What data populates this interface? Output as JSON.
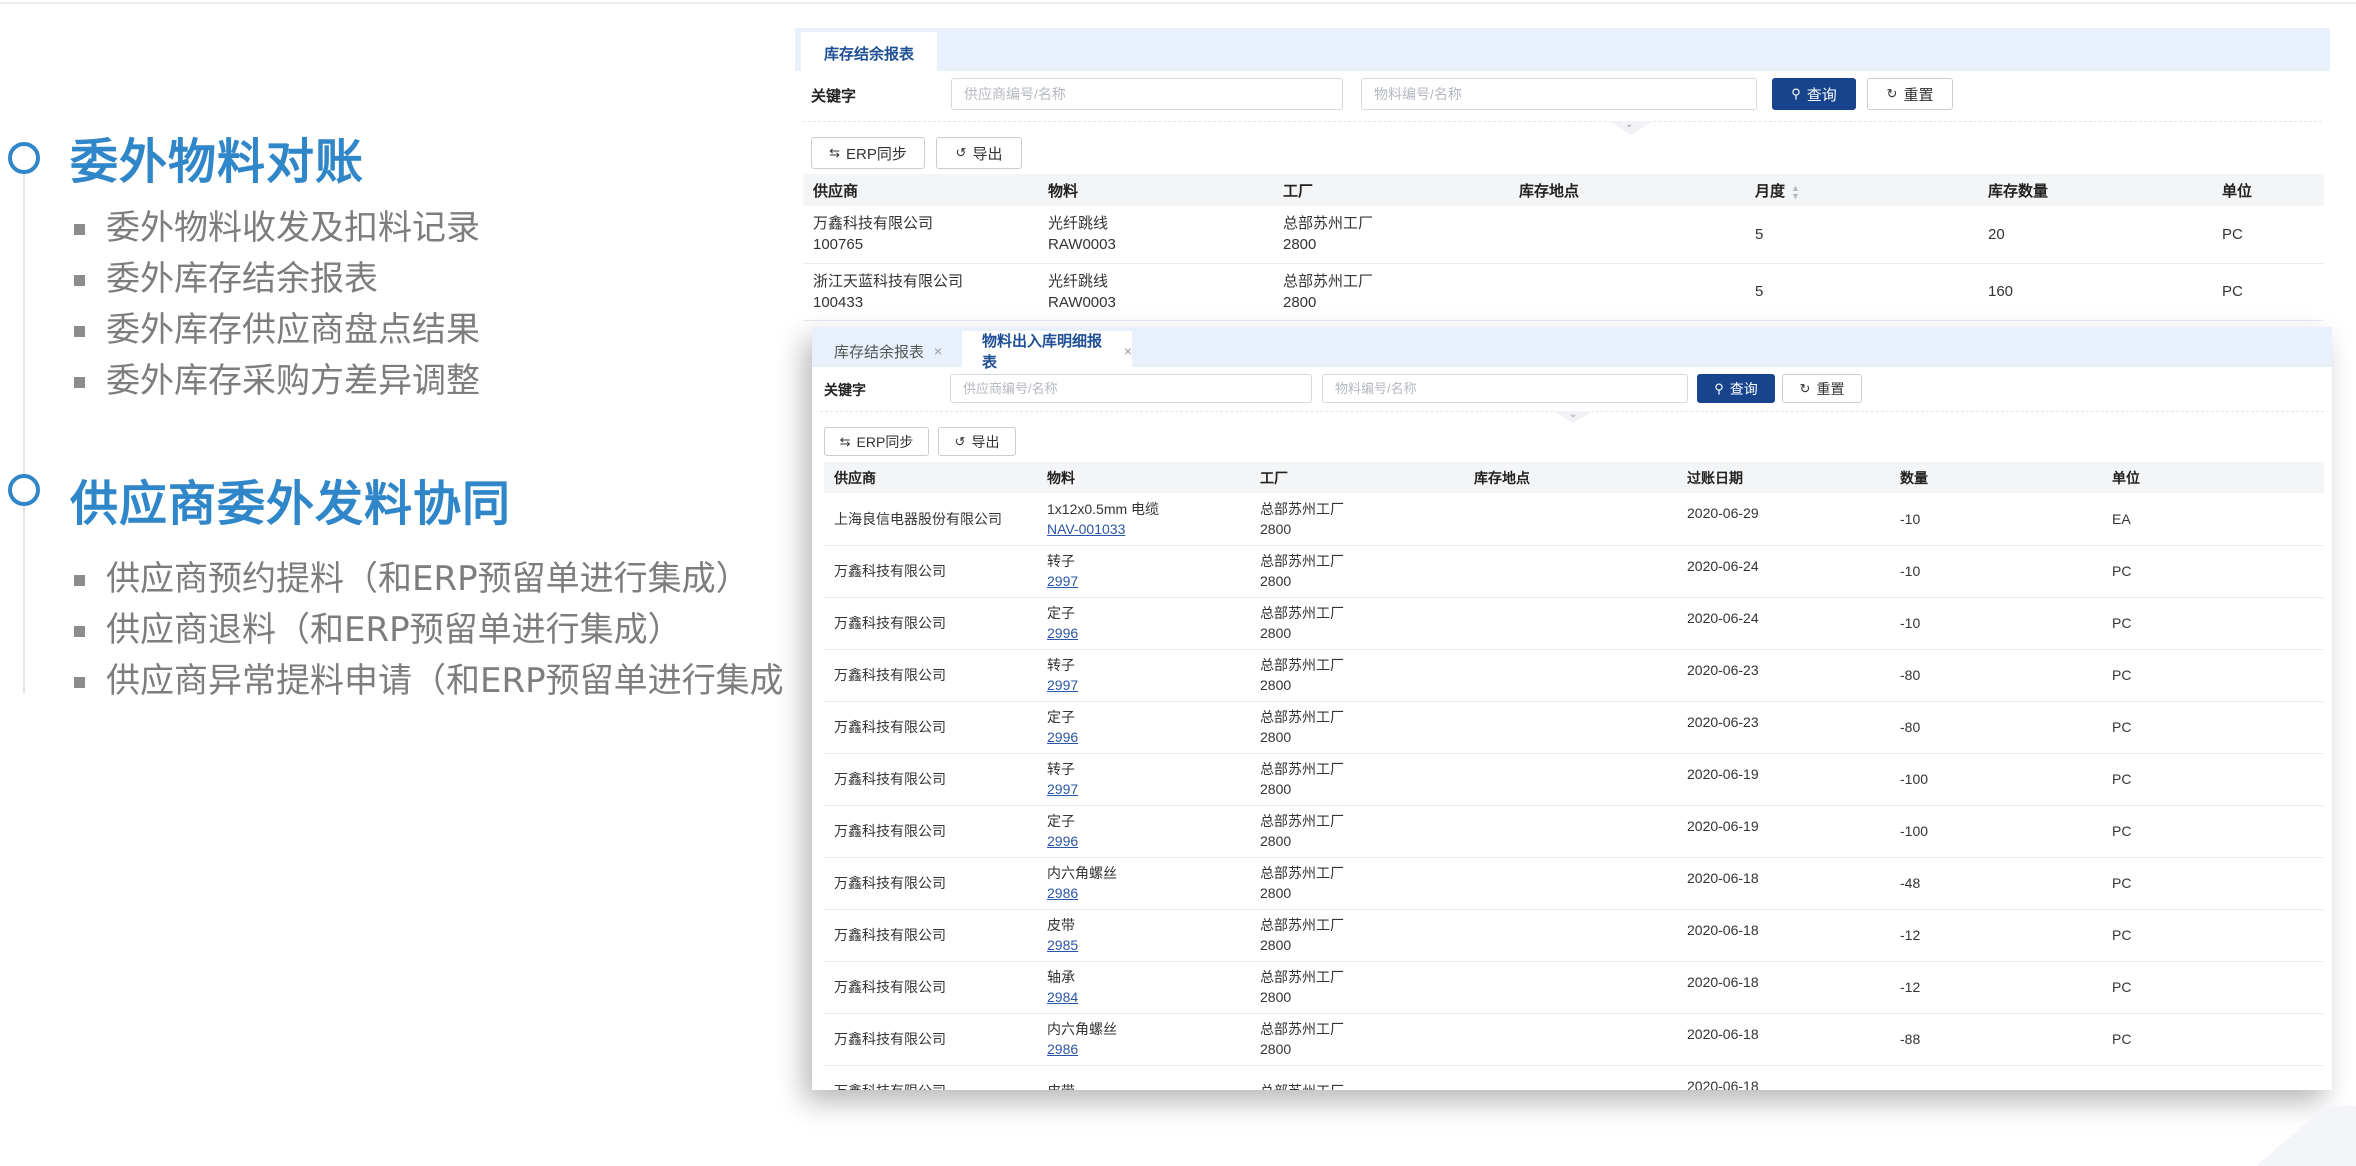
{
  "left": {
    "section1_title": "委外物料对账",
    "section1_items": [
      "委外物料收发及扣料记录",
      "委外库存结余报表",
      "委外库存供应商盘点结果",
      "委外库存采购方差异调整"
    ],
    "section2_title": "供应商委外发料协同",
    "section2_items": [
      "供应商预约提料（和ERP预留单进行集成）",
      "供应商退料（和ERP预留单进行集成）",
      "供应商异常提料申请（和ERP预留单进行集成"
    ]
  },
  "panel1": {
    "tab": "库存结余报表",
    "keyword_label": "关键字",
    "supplier_placeholder": "供应商编号/名称",
    "material_placeholder": "物料编号/名称",
    "query_label": "查询",
    "reset_label": "重置",
    "erp_sync_label": "ERP同步",
    "export_label": "导出",
    "columns": [
      "供应商",
      "物料",
      "工厂",
      "库存地点",
      "月度",
      "库存数量",
      "单位"
    ],
    "rows": [
      {
        "supplier": "万鑫科技有限公司",
        "supplier_code": "100765",
        "material": "光纤跳线",
        "material_code": "RAW0003",
        "plant": "总部苏州工厂",
        "plant_code": "2800",
        "location": "",
        "month": "5",
        "qty": "20",
        "unit": "PC"
      },
      {
        "supplier": "浙江天蓝科技有限公司",
        "supplier_code": "100433",
        "material": "光纤跳线",
        "material_code": "RAW0003",
        "plant": "总部苏州工厂",
        "plant_code": "2800",
        "location": "",
        "month": "5",
        "qty": "160",
        "unit": "PC"
      }
    ]
  },
  "panel2": {
    "tabs": [
      "库存结余报表",
      "物料出入库明细报表"
    ],
    "keyword_label": "关键字",
    "supplier_placeholder": "供应商编号/名称",
    "material_placeholder": "物料编号/名称",
    "query_label": "查询",
    "reset_label": "重置",
    "erp_sync_label": "ERP同步",
    "export_label": "导出",
    "columns": [
      "供应商",
      "物料",
      "工厂",
      "库存地点",
      "过账日期",
      "数量",
      "单位"
    ],
    "rows": [
      {
        "supplier": "上海良信电器股份有限公司",
        "material": "1x12x0.5mm 电缆",
        "material_code": "NAV-001033",
        "plant": "总部苏州工厂",
        "plant_code": "2800",
        "location": "",
        "date": "2020-06-29",
        "qty": "-10",
        "unit": "EA"
      },
      {
        "supplier": "万鑫科技有限公司",
        "material": "转子",
        "material_code": "2997",
        "plant": "总部苏州工厂",
        "plant_code": "2800",
        "location": "",
        "date": "2020-06-24",
        "qty": "-10",
        "unit": "PC"
      },
      {
        "supplier": "万鑫科技有限公司",
        "material": "定子",
        "material_code": "2996",
        "plant": "总部苏州工厂",
        "plant_code": "2800",
        "location": "",
        "date": "2020-06-24",
        "qty": "-10",
        "unit": "PC"
      },
      {
        "supplier": "万鑫科技有限公司",
        "material": "转子",
        "material_code": "2997",
        "plant": "总部苏州工厂",
        "plant_code": "2800",
        "location": "",
        "date": "2020-06-23",
        "qty": "-80",
        "unit": "PC"
      },
      {
        "supplier": "万鑫科技有限公司",
        "material": "定子",
        "material_code": "2996",
        "plant": "总部苏州工厂",
        "plant_code": "2800",
        "location": "",
        "date": "2020-06-23",
        "qty": "-80",
        "unit": "PC"
      },
      {
        "supplier": "万鑫科技有限公司",
        "material": "转子",
        "material_code": "2997",
        "plant": "总部苏州工厂",
        "plant_code": "2800",
        "location": "",
        "date": "2020-06-19",
        "qty": "-100",
        "unit": "PC"
      },
      {
        "supplier": "万鑫科技有限公司",
        "material": "定子",
        "material_code": "2996",
        "plant": "总部苏州工厂",
        "plant_code": "2800",
        "location": "",
        "date": "2020-06-19",
        "qty": "-100",
        "unit": "PC"
      },
      {
        "supplier": "万鑫科技有限公司",
        "material": "内六角螺丝",
        "material_code": "2986",
        "plant": "总部苏州工厂",
        "plant_code": "2800",
        "location": "",
        "date": "2020-06-18",
        "qty": "-48",
        "unit": "PC"
      },
      {
        "supplier": "万鑫科技有限公司",
        "material": "皮带",
        "material_code": "2985",
        "plant": "总部苏州工厂",
        "plant_code": "2800",
        "location": "",
        "date": "2020-06-18",
        "qty": "-12",
        "unit": "PC"
      },
      {
        "supplier": "万鑫科技有限公司",
        "material": "轴承",
        "material_code": "2984",
        "plant": "总部苏州工厂",
        "plant_code": "2800",
        "location": "",
        "date": "2020-06-18",
        "qty": "-12",
        "unit": "PC"
      },
      {
        "supplier": "万鑫科技有限公司",
        "material": "内六角螺丝",
        "material_code": "2986",
        "plant": "总部苏州工厂",
        "plant_code": "2800",
        "location": "",
        "date": "2020-06-18",
        "qty": "-88",
        "unit": "PC"
      },
      {
        "supplier": "万鑫科技有限公司",
        "material": "皮带",
        "material_code": "",
        "plant": "总部苏州工厂",
        "plant_code": "",
        "location": "",
        "date": "2020-06-18",
        "qty": "",
        "unit": ""
      }
    ]
  },
  "icons": {
    "search": "search-icon",
    "reset": "refresh-icon",
    "sync": "sync-icon",
    "export": "export-icon",
    "sort": "sort-icon",
    "expand": "chevron-down-icon",
    "close": "close-icon"
  },
  "colors": {
    "title_blue": "#2f86c8",
    "primary_button": "#17448c",
    "link": "#2a56a8",
    "tabbar": "#e8f1fb"
  }
}
